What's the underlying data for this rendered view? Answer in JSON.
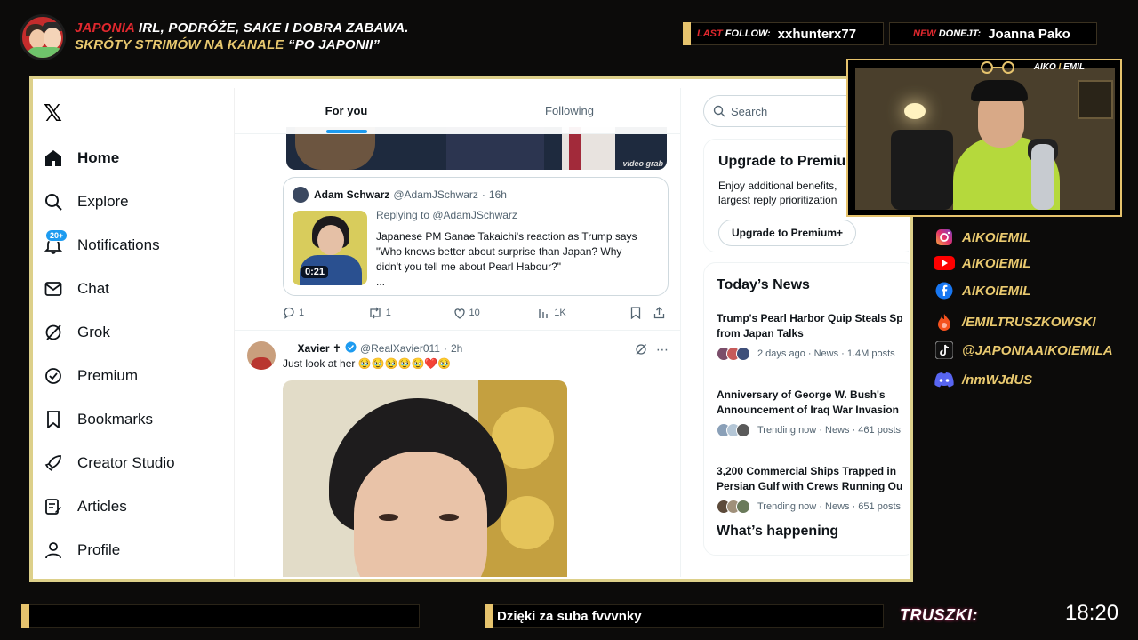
{
  "overlay": {
    "headline_line1_red": "JAPONIA",
    "headline_line1_rest": " IRL, PODRÓŻE, SAKE I DOBRA ZABAWA.",
    "headline_line2_gold": "SKRÓTY STRIMÓW NA KANALE ",
    "headline_line2_white": "“PO JAPONII”",
    "last_follow_red": "LAST",
    "last_follow_label": " FOLLOW:",
    "last_follow_value": "xxhunterx77",
    "new_donate_red": "NEW",
    "new_donate_label": " DONEJT:",
    "new_donate_value": "Joanna Pako",
    "cam_tag_a": "AIKO",
    "cam_tag_sep": " I ",
    "cam_tag_b": "EMIL",
    "accent_color": "#e6c36d"
  },
  "socials": [
    {
      "icon": "instagram-icon",
      "label": "AIKOIEMIL"
    },
    {
      "icon": "youtube-icon",
      "label": "AIKOIEMIL"
    },
    {
      "icon": "facebook-icon",
      "label": "AIKOIEMIL"
    },
    {
      "icon": "flame-icon",
      "label": "/EMILTRUSZKOWSKI"
    },
    {
      "icon": "tiktok-icon",
      "label": "@JAPONIAAIKOIEMILA"
    },
    {
      "icon": "discord-icon",
      "label": "/nmWJdUS"
    }
  ],
  "bottom": {
    "left_text": "",
    "mid_text": "Dzięki za suba fvvvnky",
    "truszki": "TRUSZKI:",
    "clock": "18:20"
  },
  "x": {
    "logo": "𝕏",
    "nav": [
      {
        "icon": "home-icon",
        "label": "Home",
        "active": true
      },
      {
        "icon": "search-icon",
        "label": "Explore"
      },
      {
        "icon": "bell-icon",
        "label": "Notifications",
        "badge": "20+"
      },
      {
        "icon": "mail-icon",
        "label": "Chat"
      },
      {
        "icon": "grok-icon",
        "label": "Grok"
      },
      {
        "icon": "premium-icon",
        "label": "Premium"
      },
      {
        "icon": "bookmark-icon",
        "label": "Bookmarks"
      },
      {
        "icon": "rocket-icon",
        "label": "Creator Studio"
      },
      {
        "icon": "articles-icon",
        "label": "Articles"
      },
      {
        "icon": "person-icon",
        "label": "Profile"
      }
    ],
    "tabs": [
      {
        "label": "For you",
        "active": true
      },
      {
        "label": "Following"
      }
    ],
    "media_top_watermark": "video grab",
    "quote": {
      "name": "Adam Schwarz",
      "handle": "@AdamJSchwarz",
      "time": "16h",
      "duration": "0:21",
      "replying": "Replying to @AdamJSchwarz",
      "text": "Japanese PM Sanae Takaichi's reaction as Trump says\n\"Who knows better about surprise than Japan? Why\ndidn't you tell me about Pearl Habour?\"\n..."
    },
    "actions": {
      "replies": "1",
      "reposts": "1",
      "likes": "10",
      "views": "1K"
    },
    "tweet2": {
      "name": "Xavier ✝",
      "handle": "@RealXavier011",
      "time": "2h",
      "text": "Just look at her 🥹🥹🥹🥹🥹❤️🥹"
    },
    "search_placeholder": "Search",
    "premium": {
      "title": "Upgrade to Premium+",
      "desc": "Enjoy additional benefits,\nlargest reply prioritization",
      "button": "Upgrade to Premium+"
    },
    "news": {
      "heading": "Today’s News",
      "items": [
        {
          "title": "Trump's Pearl Harbor Quip Steals Sp",
          "title2": "from Japan Talks",
          "meta": "2 days ago · News · 1.4M posts"
        },
        {
          "title": "Anniversary of George W. Bush's",
          "title2": "Announcement of Iraq War Invasion",
          "meta": "Trending now · News · 461 posts"
        },
        {
          "title": "3,200 Commercial Ships Trapped in",
          "title2": "Persian Gulf with Crews Running Ou",
          "meta": "Trending now · News · 651 posts"
        }
      ],
      "whats_happening": "What’s happening"
    }
  }
}
